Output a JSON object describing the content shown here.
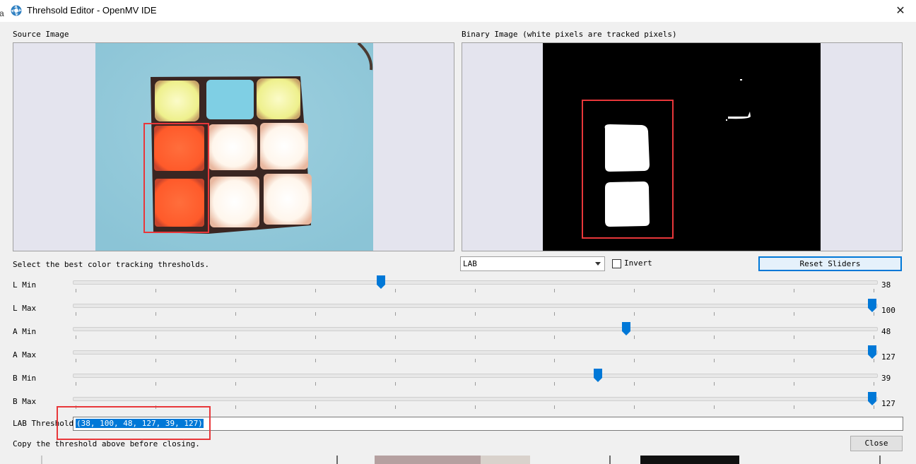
{
  "window": {
    "title": "Threhsold Editor - OpenMV IDE",
    "close_glyph": "✕",
    "edge_fragment": "a"
  },
  "source": {
    "label": "Source Image"
  },
  "binary": {
    "label": "Binary Image (white pixels are tracked pixels)"
  },
  "instructions": "Select the best color tracking thresholds.",
  "colorspace": {
    "value": "LAB",
    "options": [
      "LAB"
    ]
  },
  "invert": {
    "label": "Invert",
    "checked": false
  },
  "reset_label": "Reset Sliders",
  "sliders": [
    {
      "label": "L Min",
      "value": "38",
      "fraction": 0.382
    },
    {
      "label": "L Max",
      "value": "100",
      "fraction": 1.0
    },
    {
      "label": "A Min",
      "value": "48",
      "fraction": 0.691
    },
    {
      "label": "A Max",
      "value": "127",
      "fraction": 1.0
    },
    {
      "label": "B Min",
      "value": "39",
      "fraction": 0.655
    },
    {
      "label": "B Max",
      "value": "127",
      "fraction": 1.0
    }
  ],
  "threshold": {
    "label": "LAB Threshold",
    "value": "(38, 100, 48, 127, 39, 127)"
  },
  "footer_note": "Copy the threshold above before closing.",
  "close_label": "Close",
  "colors": {
    "accent": "#0078d7",
    "annotation": "#e8373a",
    "binary_bg": "#000000"
  },
  "icons": {
    "app": "openmv-aperture-icon",
    "close": "close-icon",
    "combo": "chevron-down-icon"
  }
}
